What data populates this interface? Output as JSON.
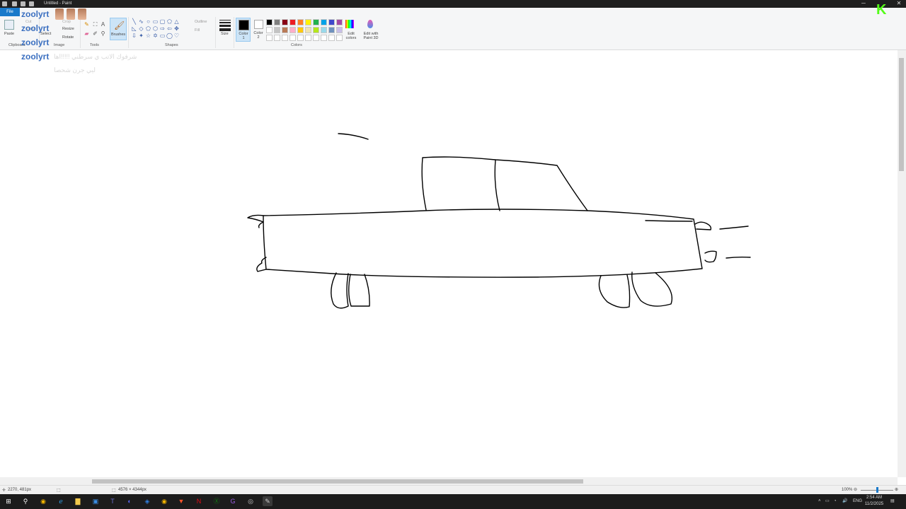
{
  "window": {
    "title": "Untitled - Paint",
    "controls": {
      "minimize": "─",
      "maximize": "☐",
      "close": "✕"
    }
  },
  "ribbon": {
    "file_tab": "File",
    "clipboard": {
      "paste_label": "Paste",
      "cut_label": "Cut",
      "copy_label": "Copy",
      "caption": "Clipboard"
    },
    "image": {
      "select_label": "Select",
      "crop_label": "Crop",
      "resize_label": "Resize",
      "rotate_label": "Rotate",
      "caption": "Image"
    },
    "tools": {
      "caption": "Tools",
      "text_tool": "A"
    },
    "brushes": {
      "label": "Brushes"
    },
    "shapes": {
      "outline_label": "Outline",
      "fill_label": "Fill",
      "caption": "Shapes"
    },
    "size": {
      "label": "Size"
    },
    "colors": {
      "color1_label": "Color 1",
      "color2_label": "Color 2",
      "edit_colors_label": "Edit colors",
      "paint3d_label": "Edit with Paint 3D",
      "caption": "Colors",
      "color1_value": "#000000",
      "color2_value": "#ffffff",
      "palette_row1": [
        "#000000",
        "#7f7f7f",
        "#880015",
        "#ed1c24",
        "#ff7f27",
        "#fff200",
        "#22b14c",
        "#00a2e8",
        "#3f48cc",
        "#a349a4"
      ],
      "palette_row2": [
        "#ffffff",
        "#c3c3c3",
        "#b97a57",
        "#ffaec9",
        "#ffc90e",
        "#efe4b0",
        "#b5e61d",
        "#99d9ea",
        "#7092be",
        "#c8bfe7"
      ],
      "palette_row3": [
        "#ffffff",
        "#ffffff",
        "#ffffff",
        "#ffffff",
        "#ffffff",
        "#ffffff",
        "#ffffff",
        "#ffffff",
        "#ffffff",
        "#ffffff"
      ]
    }
  },
  "overlay": {
    "names": [
      "zoolyrt",
      "zoolyrt",
      "zoolyrt",
      "zoolyrt"
    ],
    "message_line1": "شرفوك الاتب ي سرطني !!!!!اها",
    "message_line2": "ليي جرن شحصا"
  },
  "status": {
    "cursor_position": "2270, 481px",
    "canvas_size": "4576 × 4344px",
    "zoom": "100%"
  },
  "taskbar": {
    "icons": [
      "windows-start",
      "search",
      "chrome",
      "edge",
      "file-explorer",
      "store",
      "teams",
      "discord",
      "app-blue",
      "chrome-2",
      "brave",
      "netflix",
      "xbox",
      "gog",
      "obs",
      "paint"
    ],
    "language": "ENG",
    "time": "2:54 AM",
    "date": "11/2/2025"
  }
}
